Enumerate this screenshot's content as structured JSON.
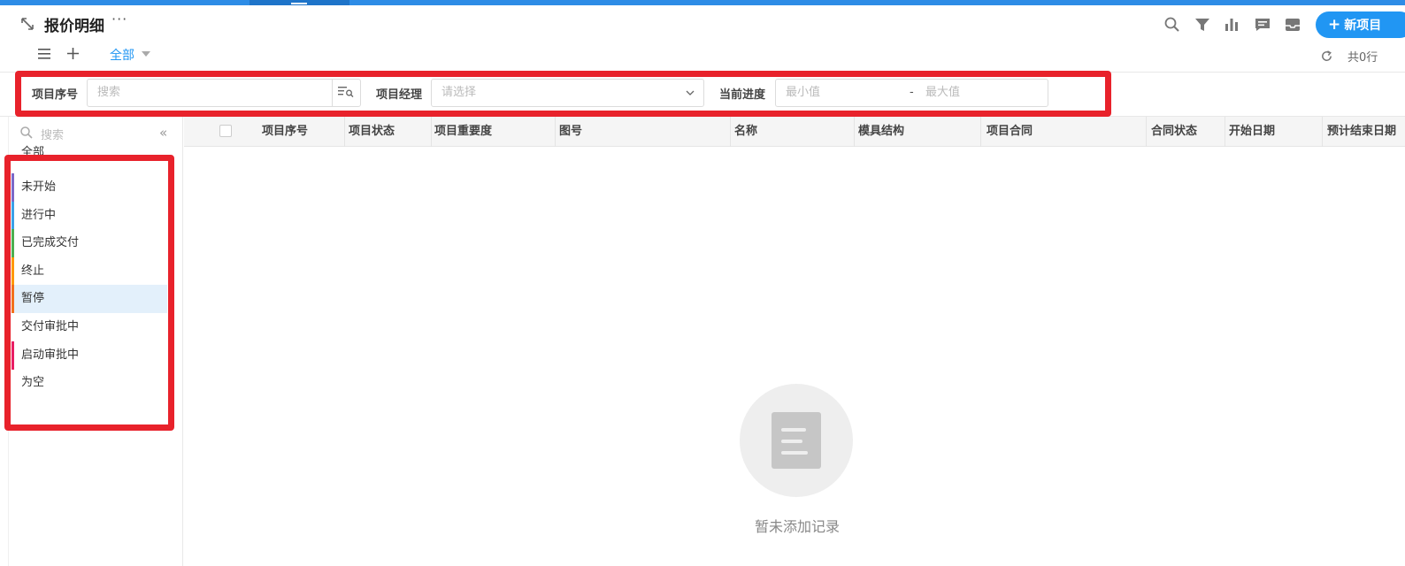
{
  "header": {
    "title": "报价明细",
    "more": "···",
    "new_button": "新项目",
    "new_button_plus": "+",
    "tab_all": "全部",
    "row_count": "共0行"
  },
  "toolbar_icons": [
    "search-icon",
    "filter-icon",
    "chart-icon",
    "comment-icon",
    "inbox-icon"
  ],
  "filters": {
    "serial_label": "项目序号",
    "serial_placeholder": "搜索",
    "manager_label": "项目经理",
    "manager_placeholder": "请选择",
    "progress_label": "当前进度",
    "progress_min": "最小值",
    "progress_dash": "-",
    "progress_max": "最大值"
  },
  "sidebar": {
    "search_placeholder": "搜索",
    "collapse": "«",
    "items": [
      {
        "label": "全部",
        "color": ""
      },
      {
        "label": "未开始",
        "color": "#7b68c8"
      },
      {
        "label": "进行中",
        "color": "#3aa0e8"
      },
      {
        "label": "已完成交付",
        "color": "#4caf50"
      },
      {
        "label": "终止",
        "color": "#ff9800"
      },
      {
        "label": "暂停",
        "color": "#f2711c"
      },
      {
        "label": "交付审批中",
        "color": ""
      },
      {
        "label": "启动审批中",
        "color": "#e91e63"
      },
      {
        "label": "为空",
        "color": ""
      }
    ]
  },
  "table": {
    "columns": [
      "项目序号",
      "项目状态",
      "项目重要度",
      "图号",
      "名称",
      "模具结构",
      "项目合同",
      "合同状态",
      "开始日期",
      "预计结束日期"
    ]
  },
  "empty_state": {
    "message": "暂未添加记录"
  },
  "colors": {
    "accent": "#2196f3",
    "highlight": "#e8222b"
  }
}
